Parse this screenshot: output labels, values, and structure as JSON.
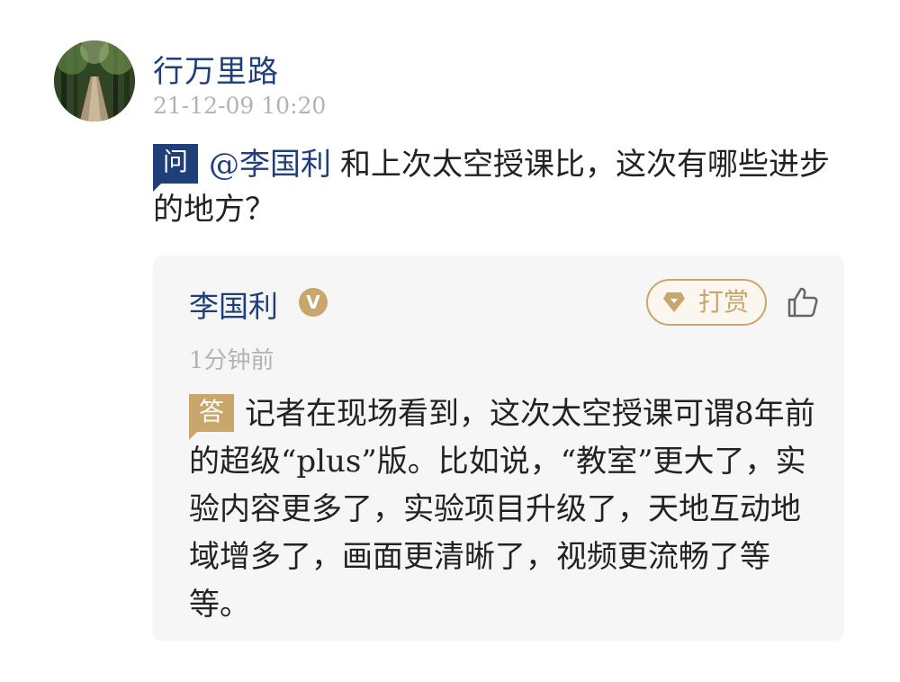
{
  "question_post": {
    "user_name": "行万里路",
    "timestamp": "21-12-09 10:20",
    "badge_label": "问",
    "mention": "@李国利",
    "text": "和上次太空授课比，这次有哪些进步的地方？"
  },
  "answer": {
    "author_name": "李国利",
    "verified_label": "V",
    "reward_label": "打赏",
    "time": "1分钟前",
    "badge_label": "答",
    "text": "记者在现场看到，这次太空授课可谓8年前的超级“plus”版。比如说，“教室”更大了，实验内容更多了，实验项目升级了，天地互动地域增多了，画面更清晰了，视频更流畅了等等。"
  },
  "colors": {
    "brand_blue": "#1f3f7a",
    "gold": "#c9a66b",
    "muted_gray": "#b3b3b3",
    "card_bg": "#f6f6f6",
    "text": "#222222"
  },
  "icons": {
    "avatar": "forest-path-photo",
    "verified": "verified-badge-icon",
    "reward": "gem-icon",
    "like": "thumbs-up-icon"
  }
}
